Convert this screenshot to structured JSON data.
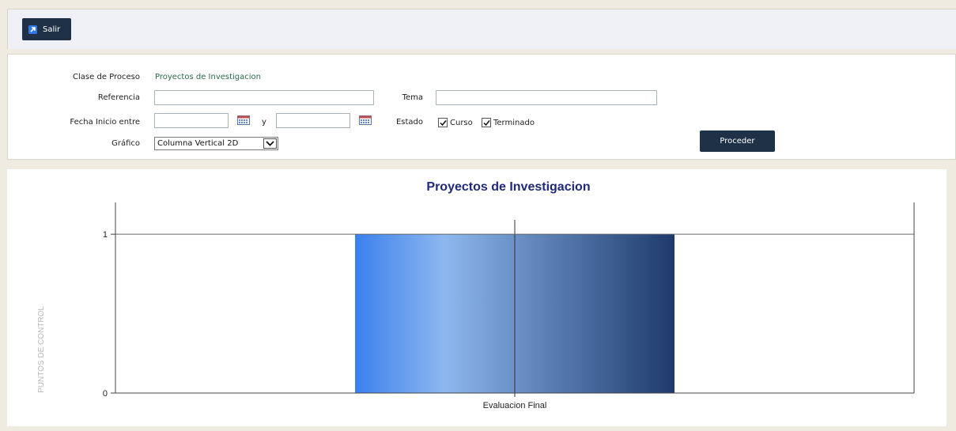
{
  "toolbar": {
    "exit_label": "Salir"
  },
  "form": {
    "clase_label": "Clase de Proceso",
    "clase_value": "Proyectos de Investigacion",
    "referencia_label": "Referencia",
    "referencia_value": "",
    "tema_label": "Tema",
    "tema_value": "",
    "fecha_label": "Fecha Inicio entre",
    "fecha_from": "",
    "fecha_y": "y",
    "fecha_to": "",
    "estado_label": "Estado",
    "estado_options": [
      {
        "label": "Curso",
        "checked": true
      },
      {
        "label": "Terminado",
        "checked": true
      }
    ],
    "grafico_label": "Gráfico",
    "grafico_value": "Columna Vertical 2D",
    "submit_label": "Proceder"
  },
  "chart_data": {
    "type": "bar",
    "title": "Proyectos de Investigacion",
    "ylabel": "PUNTOS DE CONTROL",
    "xlabel": "",
    "categories": [
      "Evaluacion Final"
    ],
    "values": [
      1
    ],
    "ylim": [
      0,
      1.2
    ],
    "yticks": [
      0,
      1
    ],
    "grid": false,
    "colors": {
      "title": "#1f2a7a",
      "bar_start": "#3a80ee",
      "bar_mid": "#8db8ef",
      "bar_end": "#1e3a6b"
    }
  }
}
